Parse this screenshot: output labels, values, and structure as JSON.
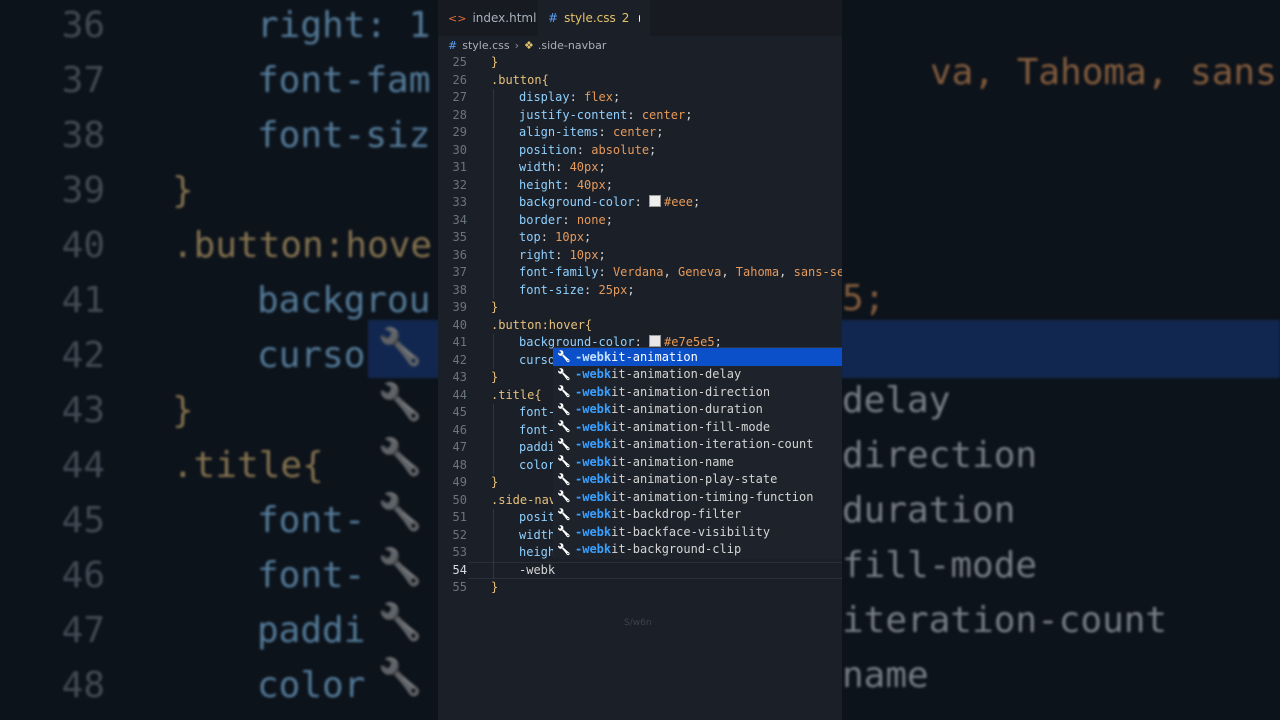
{
  "background": {
    "lines": [
      {
        "num": "36",
        "code": "right: 1"
      },
      {
        "num": "37",
        "code": "font-fam"
      },
      {
        "num": "38",
        "code": "font-siz"
      },
      {
        "num": "39",
        "code": "}"
      },
      {
        "num": "40",
        "code": ".button:hove"
      },
      {
        "num": "41",
        "code": "backgrou"
      },
      {
        "num": "42",
        "code": "curso"
      },
      {
        "num": "43",
        "code": "}"
      },
      {
        "num": "44",
        "code": ".title{"
      },
      {
        "num": "45",
        "code": "font-"
      },
      {
        "num": "46",
        "code": "font-"
      },
      {
        "num": "47",
        "code": "paddi"
      },
      {
        "num": "48",
        "code": "color"
      }
    ],
    "right_texts": [
      "va, Tahoma, sans-ser",
      "5;",
      "delay",
      "direction",
      "duration",
      "fill-mode",
      "iteration-count",
      "name"
    ]
  },
  "tabs": [
    {
      "label": "index.html",
      "icon": "html-icon"
    },
    {
      "label": "style.css",
      "count": "2",
      "icon": "css-hash-icon"
    }
  ],
  "breadcrumb": {
    "file": "style.css",
    "symbol": ".side-navbar"
  },
  "code_lines": [
    {
      "n": "25",
      "parts": [
        [
          "brace",
          "}"
        ]
      ]
    },
    {
      "n": "26",
      "parts": [
        [
          "sel",
          ".button"
        ],
        [
          "brace",
          "{"
        ]
      ]
    },
    {
      "n": "27",
      "indent": true,
      "parts": [
        [
          "prop",
          "display"
        ],
        [
          "punc",
          ": "
        ],
        [
          "val",
          "flex"
        ],
        [
          "punc",
          ";"
        ]
      ]
    },
    {
      "n": "28",
      "indent": true,
      "parts": [
        [
          "prop",
          "justify-content"
        ],
        [
          "punc",
          ": "
        ],
        [
          "val",
          "center"
        ],
        [
          "punc",
          ";"
        ]
      ]
    },
    {
      "n": "29",
      "indent": true,
      "parts": [
        [
          "prop",
          "align-items"
        ],
        [
          "punc",
          ": "
        ],
        [
          "val",
          "center"
        ],
        [
          "punc",
          ";"
        ]
      ]
    },
    {
      "n": "30",
      "indent": true,
      "parts": [
        [
          "prop",
          "position"
        ],
        [
          "punc",
          ": "
        ],
        [
          "val",
          "absolute"
        ],
        [
          "punc",
          ";"
        ]
      ]
    },
    {
      "n": "31",
      "indent": true,
      "parts": [
        [
          "prop",
          "width"
        ],
        [
          "punc",
          ": "
        ],
        [
          "val",
          "40px"
        ],
        [
          "punc",
          ";"
        ]
      ]
    },
    {
      "n": "32",
      "indent": true,
      "parts": [
        [
          "prop",
          "height"
        ],
        [
          "punc",
          ": "
        ],
        [
          "val",
          "40px"
        ],
        [
          "punc",
          ";"
        ]
      ]
    },
    {
      "n": "33",
      "indent": true,
      "parts": [
        [
          "prop",
          "background-color"
        ],
        [
          "punc",
          ": "
        ],
        [
          "swatch",
          "#eee"
        ],
        [
          "val",
          "#eee"
        ],
        [
          "punc",
          ";"
        ]
      ]
    },
    {
      "n": "34",
      "indent": true,
      "parts": [
        [
          "prop",
          "border"
        ],
        [
          "punc",
          ": "
        ],
        [
          "val",
          "none"
        ],
        [
          "punc",
          ";"
        ]
      ]
    },
    {
      "n": "35",
      "indent": true,
      "parts": [
        [
          "prop",
          "top"
        ],
        [
          "punc",
          ": "
        ],
        [
          "val",
          "10px"
        ],
        [
          "punc",
          ";"
        ]
      ]
    },
    {
      "n": "36",
      "indent": true,
      "parts": [
        [
          "prop",
          "right"
        ],
        [
          "punc",
          ": "
        ],
        [
          "val",
          "10px"
        ],
        [
          "punc",
          ";"
        ]
      ]
    },
    {
      "n": "37",
      "indent": true,
      "parts": [
        [
          "prop",
          "font-family"
        ],
        [
          "punc",
          ": "
        ],
        [
          "val",
          "Verdana"
        ],
        [
          "punc",
          ", "
        ],
        [
          "val",
          "Geneva"
        ],
        [
          "punc",
          ", "
        ],
        [
          "val",
          "Tahoma"
        ],
        [
          "punc",
          ", "
        ],
        [
          "val",
          "sans-ser"
        ]
      ]
    },
    {
      "n": "38",
      "indent": true,
      "parts": [
        [
          "prop",
          "font-size"
        ],
        [
          "punc",
          ": "
        ],
        [
          "val",
          "25px"
        ],
        [
          "punc",
          ";"
        ]
      ]
    },
    {
      "n": "39",
      "parts": [
        [
          "brace",
          "}"
        ]
      ]
    },
    {
      "n": "40",
      "parts": [
        [
          "sel",
          ".button:hover"
        ],
        [
          "brace",
          "{"
        ]
      ]
    },
    {
      "n": "41",
      "indent": true,
      "parts": [
        [
          "prop",
          "background-color"
        ],
        [
          "punc",
          ": "
        ],
        [
          "swatch",
          "#e7e5e5"
        ],
        [
          "val",
          "#e7e5e5"
        ],
        [
          "punc",
          ";"
        ]
      ]
    },
    {
      "n": "42",
      "indent": true,
      "parts": [
        [
          "prop",
          "curso"
        ]
      ]
    },
    {
      "n": "43",
      "parts": [
        [
          "brace",
          "}"
        ]
      ]
    },
    {
      "n": "44",
      "parts": [
        [
          "sel",
          ".title"
        ],
        [
          "brace",
          "{"
        ]
      ]
    },
    {
      "n": "45",
      "indent": true,
      "parts": [
        [
          "prop",
          "font-"
        ]
      ]
    },
    {
      "n": "46",
      "indent": true,
      "parts": [
        [
          "prop",
          "font-"
        ]
      ]
    },
    {
      "n": "47",
      "indent": true,
      "parts": [
        [
          "prop",
          "paddi"
        ]
      ]
    },
    {
      "n": "48",
      "indent": true,
      "parts": [
        [
          "prop",
          "color"
        ]
      ]
    },
    {
      "n": "49",
      "parts": [
        [
          "brace",
          "}"
        ]
      ]
    },
    {
      "n": "50",
      "parts": [
        [
          "sel",
          ".side-nav"
        ]
      ]
    },
    {
      "n": "51",
      "indent": true,
      "parts": [
        [
          "prop",
          "posit"
        ]
      ]
    },
    {
      "n": "52",
      "indent": true,
      "parts": [
        [
          "prop",
          "width"
        ]
      ]
    },
    {
      "n": "53",
      "indent": true,
      "parts": [
        [
          "prop",
          "heigh"
        ]
      ]
    },
    {
      "n": "54",
      "indent": true,
      "current": true,
      "parts": [
        [
          "punc",
          "-webk"
        ]
      ]
    },
    {
      "n": "55",
      "parts": [
        [
          "brace",
          "}"
        ]
      ]
    }
  ],
  "watermark": "S/w6n",
  "suggestions": {
    "typed": "-webk",
    "items": [
      {
        "rest": "it-animation"
      },
      {
        "rest": "it-animation-delay"
      },
      {
        "rest": "it-animation-direction"
      },
      {
        "rest": "it-animation-duration"
      },
      {
        "rest": "it-animation-fill-mode"
      },
      {
        "rest": "it-animation-iteration-count"
      },
      {
        "rest": "it-animation-name"
      },
      {
        "rest": "it-animation-play-state"
      },
      {
        "rest": "it-animation-timing-function"
      },
      {
        "rest": "it-backdrop-filter"
      },
      {
        "rest": "it-backface-visibility"
      },
      {
        "rest": "it-background-clip"
      }
    ],
    "selected_index": 0
  }
}
